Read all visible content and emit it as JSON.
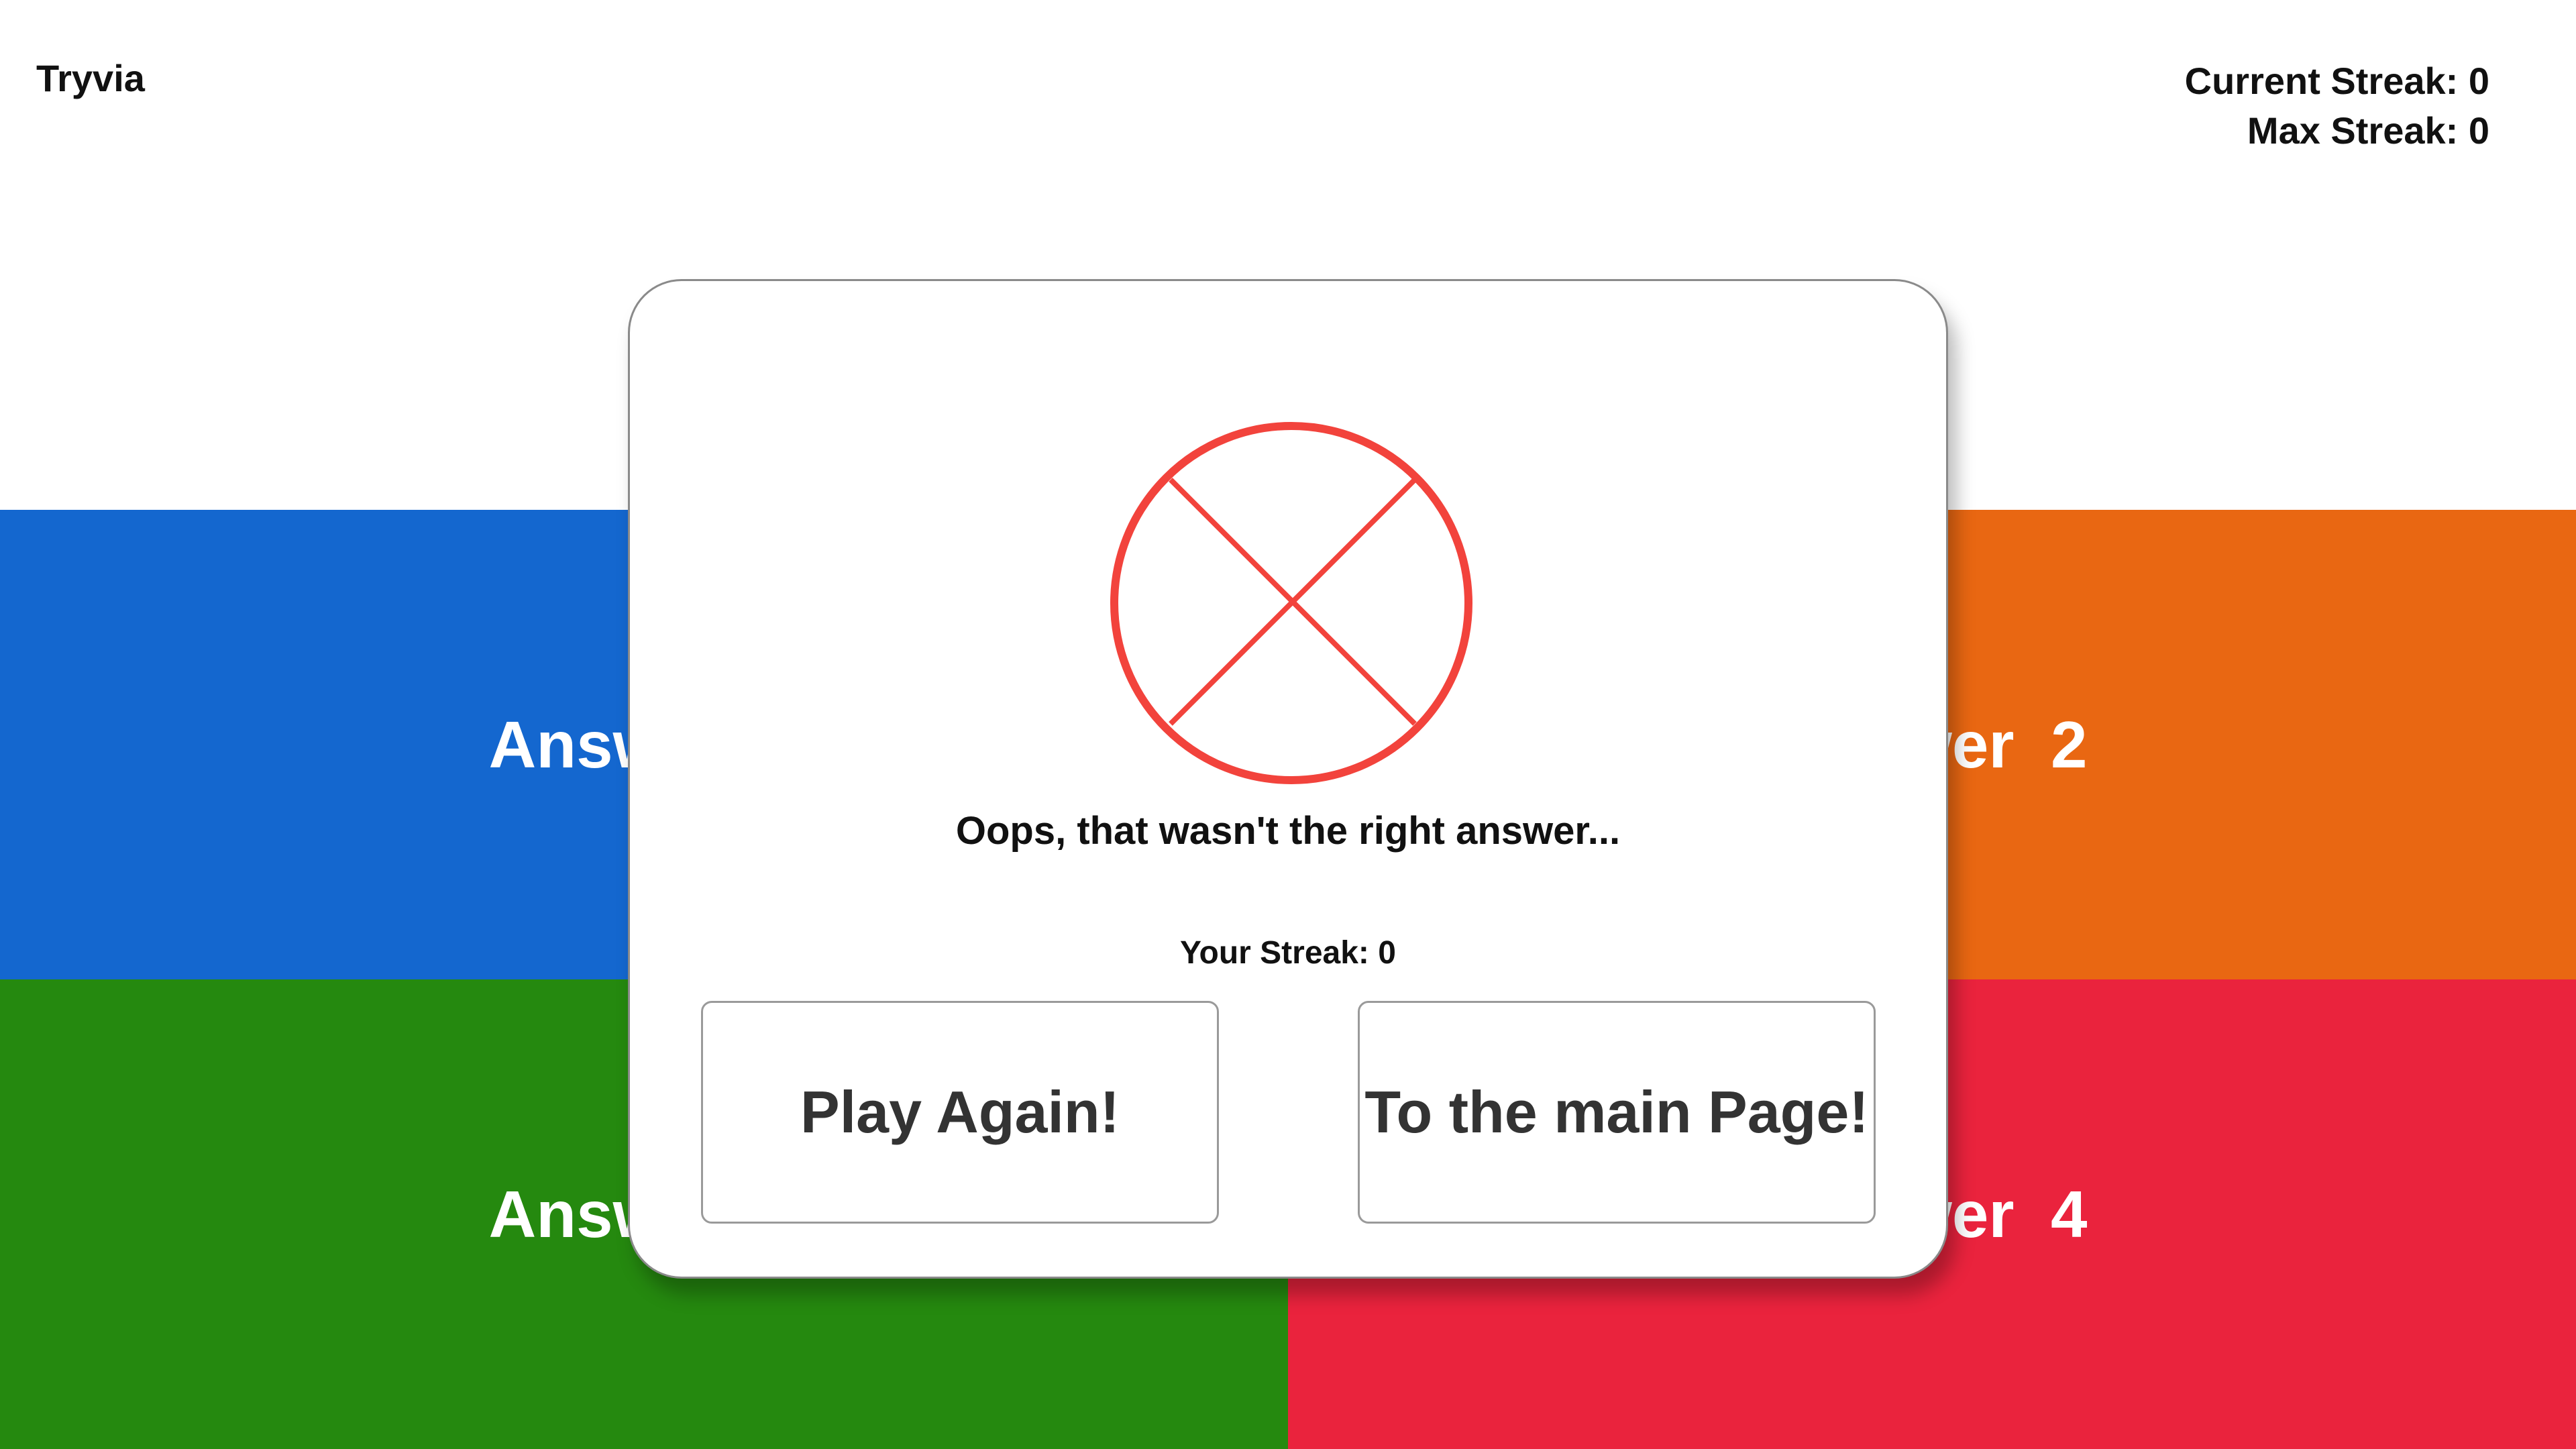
{
  "header": {
    "app_title": "Tryvia",
    "current_streak": "Current Streak: 0",
    "max_streak": "Max Streak: 0"
  },
  "answers": [
    {
      "label": "Answer  1",
      "color": "#1467cf"
    },
    {
      "label": "Answer  2",
      "color": "#e96712"
    },
    {
      "label": "Answer  3",
      "color": "#25890f"
    },
    {
      "label": "Answer  4",
      "color": "#ea233d"
    }
  ],
  "modal": {
    "icon": "wrong-answer-x-circle-icon",
    "icon_color": "#f2433c",
    "message": "Oops, that wasn't the right answer...",
    "your_streak": "Your Streak: 0",
    "play_again_label": "Play Again!",
    "main_page_label": "To the main Page!"
  }
}
